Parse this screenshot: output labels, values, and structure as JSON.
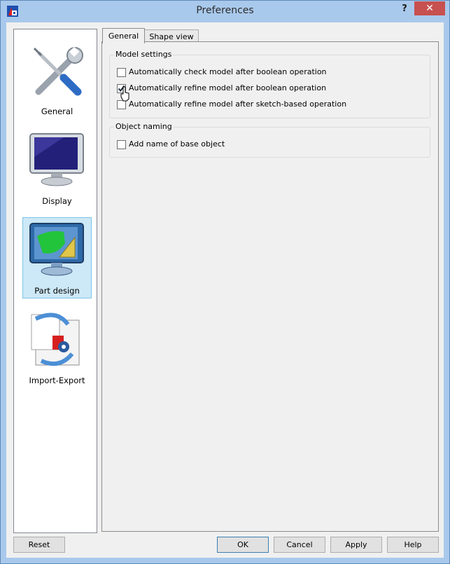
{
  "window": {
    "title": "Preferences",
    "help_label": "?",
    "close_label": "✕",
    "app_icon": "freecad-app-icon"
  },
  "sidebar": {
    "items": [
      {
        "label": "General",
        "icon": "tools-icon",
        "selected": false
      },
      {
        "label": "Display",
        "icon": "monitor-icon",
        "selected": false
      },
      {
        "label": "Part design",
        "icon": "part-design-icon",
        "selected": true
      },
      {
        "label": "Import-Export",
        "icon": "import-export-icon",
        "selected": false
      }
    ]
  },
  "tabs": [
    {
      "label": "General",
      "active": true
    },
    {
      "label": "Shape view",
      "active": false
    }
  ],
  "groups": {
    "model_settings": {
      "title": "Model settings",
      "options": [
        {
          "label": "Automatically check model after boolean operation",
          "checked": false
        },
        {
          "label": "Automatically refine model after boolean operation",
          "checked": true
        },
        {
          "label": "Automatically refine model after sketch-based operation",
          "checked": false
        }
      ]
    },
    "object_naming": {
      "title": "Object naming",
      "options": [
        {
          "label": "Add name of base object",
          "checked": false
        }
      ]
    }
  },
  "buttons": {
    "reset": "Reset",
    "ok": "OK",
    "cancel": "Cancel",
    "apply": "Apply",
    "help": "Help"
  },
  "colors": {
    "frame": "#a9c9ec",
    "close": "#c75050",
    "selection": "#cde8f6"
  }
}
